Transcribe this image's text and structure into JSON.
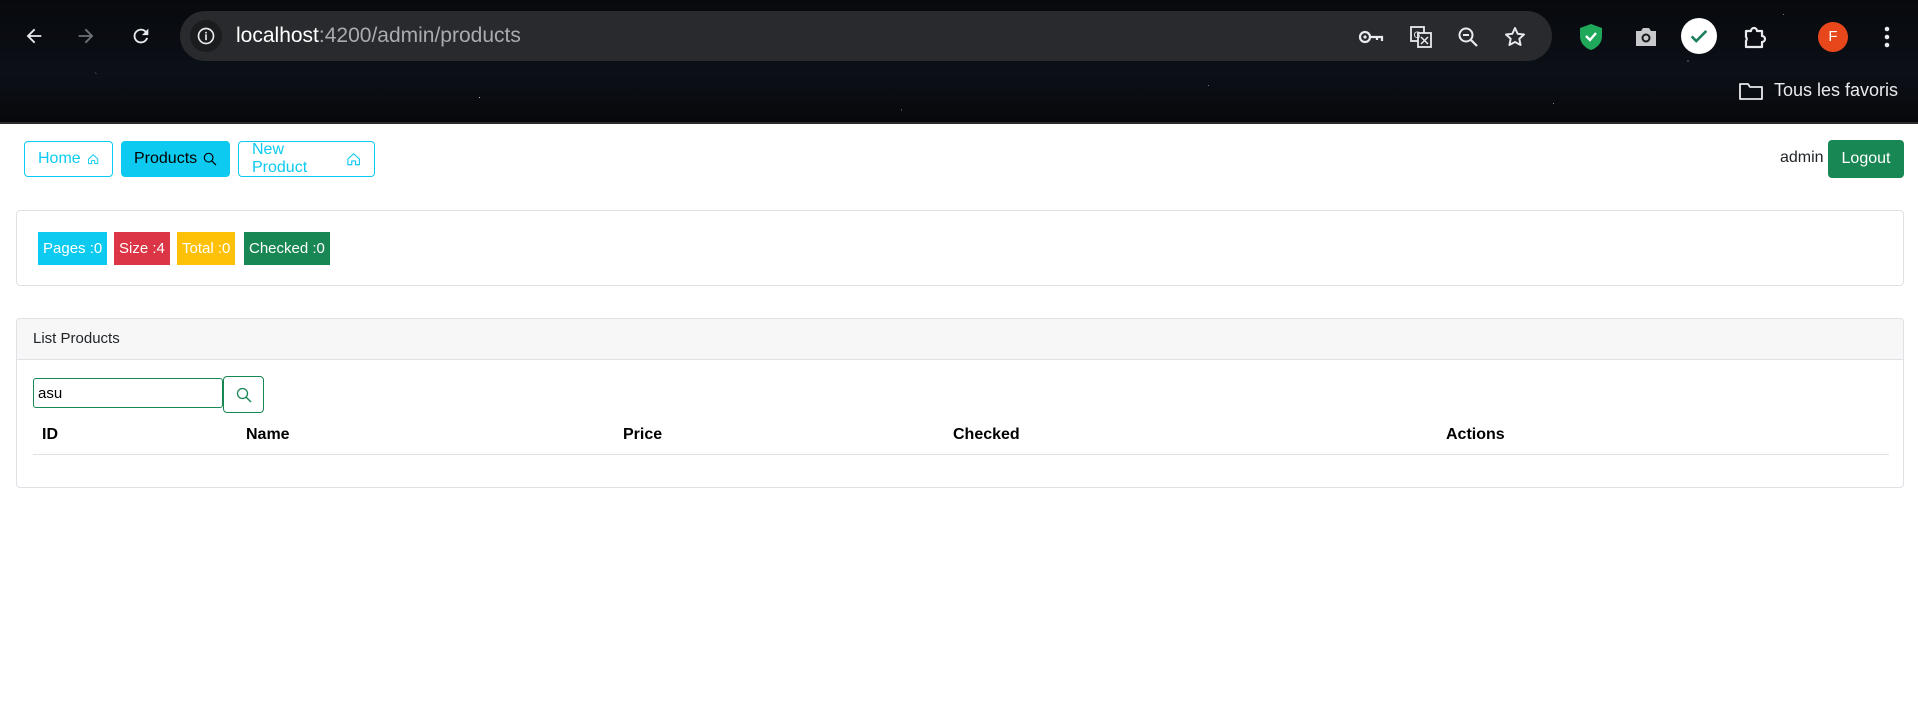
{
  "browser": {
    "url_host": "localhost",
    "url_path": ":4200/admin/products",
    "bookmarks_label": "Tous les favoris",
    "avatar_letter": "F",
    "icons": [
      "back-icon",
      "forward-icon",
      "reload-icon",
      "site-info-icon",
      "password-key-icon",
      "translate-icon",
      "zoom-out-icon",
      "bookmark-star-icon",
      "shield-extension-icon",
      "camera-extension-icon",
      "check-extension-icon",
      "extensions-puzzle-icon",
      "kebab-menu-icon",
      "folder-icon"
    ]
  },
  "nav": {
    "home_label": "Home",
    "products_label": "Products",
    "new_product_label": "New Product",
    "username": "admin",
    "logout_label": "Logout"
  },
  "stats": {
    "pages": "Pages :0",
    "size": "Size :4",
    "total": "Total :0",
    "checked": "Checked :0"
  },
  "colors": {
    "info": "#0dcaf0",
    "danger": "#dc3545",
    "warning": "#ffc107",
    "success": "#198754"
  },
  "list": {
    "title": "List Products",
    "search_value": "asu",
    "columns": [
      "ID",
      "Name",
      "Price",
      "Checked",
      "Actions"
    ]
  }
}
